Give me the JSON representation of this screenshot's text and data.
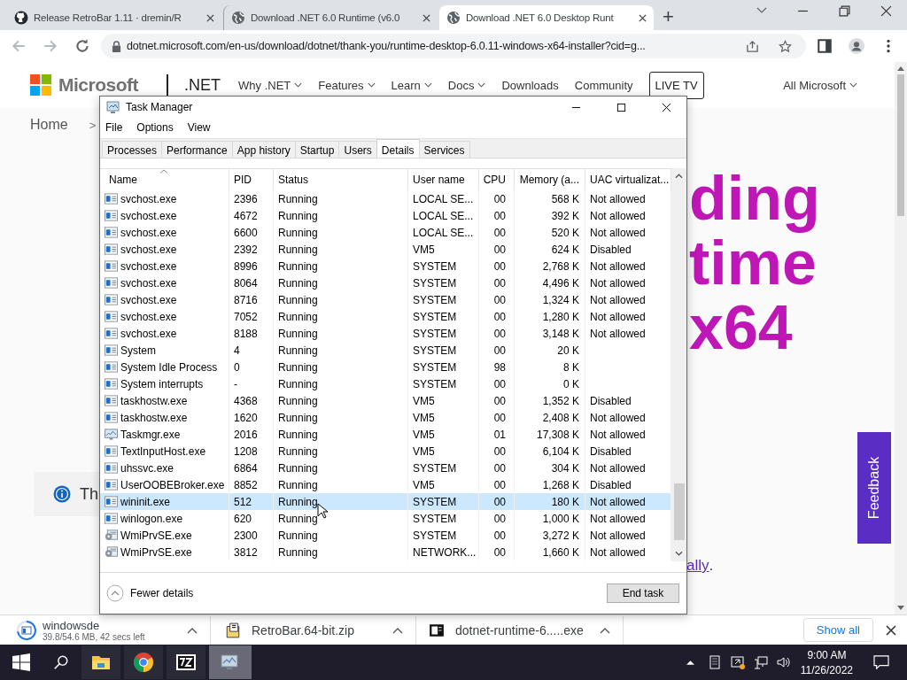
{
  "browser": {
    "tabs": [
      {
        "title": "Release RetroBar 1.11 · dremin/R",
        "kind": "github",
        "selected": false
      },
      {
        "title": "Download .NET 6.0 Runtime (v6.0",
        "kind": "globe",
        "selected": false
      },
      {
        "title": "Download .NET 6.0 Desktop Runt",
        "kind": "globe",
        "selected": true
      }
    ],
    "new_tab": "+",
    "address": "dotnet.microsoft.com/en-us/download/dotnet/thank-you/runtime-desktop-6.0.11-windows-x64-installer?cid=g..."
  },
  "page": {
    "brand": "Microsoft",
    "product": ".NET",
    "nav": [
      {
        "label": "Why .NET",
        "dropdown": true
      },
      {
        "label": "Features",
        "dropdown": true
      },
      {
        "label": "Learn",
        "dropdown": true
      },
      {
        "label": "Docs",
        "dropdown": true
      },
      {
        "label": "Downloads",
        "dropdown": false
      },
      {
        "label": "Community",
        "dropdown": false
      }
    ],
    "live_tv": "LIVE TV",
    "all_microsoft": "All Microsoft",
    "breadcrumb": [
      "Home",
      ">"
    ],
    "headline": [
      "ding",
      "time",
      "x64"
    ],
    "notice": "Th",
    "link": "ally",
    "link_after": ".",
    "feedback": "Feedback"
  },
  "downloads": {
    "items": [
      {
        "name": "windowsde",
        "progress": "39.8/54.6 MB, 42 secs left",
        "kind": "installer"
      },
      {
        "name": "RetroBar.64-bit.zip",
        "kind": "zip"
      },
      {
        "name": "dotnet-runtime-6.....exe",
        "kind": "exe"
      }
    ],
    "show_all": "Show all"
  },
  "task_manager": {
    "title": "Task Manager",
    "menu": [
      "File",
      "Options",
      "View"
    ],
    "tabs": [
      {
        "label": "Processes",
        "selected": false
      },
      {
        "label": "Performance",
        "selected": false
      },
      {
        "label": "App history",
        "selected": false
      },
      {
        "label": "Startup",
        "selected": false
      },
      {
        "label": "Users",
        "selected": false
      },
      {
        "label": "Details",
        "selected": true
      },
      {
        "label": "Services",
        "selected": false
      }
    ],
    "columns": [
      "Name",
      "PID",
      "Status",
      "User name",
      "CPU",
      "Memory (a...",
      "UAC virtualizat..."
    ],
    "rows": [
      {
        "kind": "app",
        "name": "svchost.exe",
        "pid": "2396",
        "status": "Running",
        "user": "LOCAL SE...",
        "cpu": "00",
        "memory": "568 K",
        "uac": "Not allowed",
        "selected": false
      },
      {
        "kind": "app",
        "name": "svchost.exe",
        "pid": "4672",
        "status": "Running",
        "user": "LOCAL SE...",
        "cpu": "00",
        "memory": "392 K",
        "uac": "Not allowed",
        "selected": false
      },
      {
        "kind": "app",
        "name": "svchost.exe",
        "pid": "6600",
        "status": "Running",
        "user": "LOCAL SE...",
        "cpu": "00",
        "memory": "520 K",
        "uac": "Not allowed",
        "selected": false
      },
      {
        "kind": "app",
        "name": "svchost.exe",
        "pid": "2392",
        "status": "Running",
        "user": "VM5",
        "cpu": "00",
        "memory": "624 K",
        "uac": "Disabled",
        "selected": false
      },
      {
        "kind": "app",
        "name": "svchost.exe",
        "pid": "8996",
        "status": "Running",
        "user": "SYSTEM",
        "cpu": "00",
        "memory": "2,768 K",
        "uac": "Not allowed",
        "selected": false
      },
      {
        "kind": "app",
        "name": "svchost.exe",
        "pid": "8064",
        "status": "Running",
        "user": "SYSTEM",
        "cpu": "00",
        "memory": "4,496 K",
        "uac": "Not allowed",
        "selected": false
      },
      {
        "kind": "app",
        "name": "svchost.exe",
        "pid": "8716",
        "status": "Running",
        "user": "SYSTEM",
        "cpu": "00",
        "memory": "1,324 K",
        "uac": "Not allowed",
        "selected": false
      },
      {
        "kind": "app",
        "name": "svchost.exe",
        "pid": "7052",
        "status": "Running",
        "user": "SYSTEM",
        "cpu": "00",
        "memory": "1,280 K",
        "uac": "Not allowed",
        "selected": false
      },
      {
        "kind": "app",
        "name": "svchost.exe",
        "pid": "8188",
        "status": "Running",
        "user": "SYSTEM",
        "cpu": "00",
        "memory": "3,148 K",
        "uac": "Not allowed",
        "selected": false
      },
      {
        "kind": "app",
        "name": "System",
        "pid": "4",
        "status": "Running",
        "user": "SYSTEM",
        "cpu": "00",
        "memory": "20 K",
        "selected": false
      },
      {
        "kind": "app",
        "name": "System Idle Process",
        "pid": "0",
        "status": "Running",
        "user": "SYSTEM",
        "cpu": "98",
        "memory": "8 K",
        "selected": false
      },
      {
        "kind": "app",
        "name": "System interrupts",
        "pid": "-",
        "status": "Running",
        "user": "SYSTEM",
        "cpu": "00",
        "memory": "0 K",
        "selected": false
      },
      {
        "kind": "app",
        "name": "taskhostw.exe",
        "pid": "4368",
        "status": "Running",
        "user": "VM5",
        "cpu": "00",
        "memory": "1,352 K",
        "uac": "Disabled",
        "selected": false
      },
      {
        "kind": "app",
        "name": "taskhostw.exe",
        "pid": "1620",
        "status": "Running",
        "user": "VM5",
        "cpu": "00",
        "memory": "2,408 K",
        "uac": "Not allowed",
        "selected": false
      },
      {
        "kind": "monitor",
        "name": "Taskmgr.exe",
        "pid": "2016",
        "status": "Running",
        "user": "VM5",
        "cpu": "01",
        "memory": "17,308 K",
        "uac": "Not allowed",
        "selected": false
      },
      {
        "kind": "app",
        "name": "TextInputHost.exe",
        "pid": "1208",
        "status": "Running",
        "user": "VM5",
        "cpu": "00",
        "memory": "6,104 K",
        "uac": "Disabled",
        "selected": false
      },
      {
        "kind": "app",
        "name": "uhssvc.exe",
        "pid": "6864",
        "status": "Running",
        "user": "SYSTEM",
        "cpu": "00",
        "memory": "304 K",
        "uac": "Not allowed",
        "selected": false
      },
      {
        "kind": "app",
        "name": "UserOOBEBroker.exe",
        "pid": "8852",
        "status": "Running",
        "user": "VM5",
        "cpu": "00",
        "memory": "1,268 K",
        "uac": "Disabled",
        "selected": false
      },
      {
        "kind": "app",
        "name": "wininit.exe",
        "pid": "512",
        "status": "Running",
        "user": "SYSTEM",
        "cpu": "00",
        "memory": "180 K",
        "uac": "Not allowed",
        "selected": true
      },
      {
        "kind": "app",
        "name": "winlogon.exe",
        "pid": "620",
        "status": "Running",
        "user": "SYSTEM",
        "cpu": "00",
        "memory": "1,000 K",
        "uac": "Not allowed",
        "selected": false
      },
      {
        "kind": "service",
        "name": "WmiPrvSE.exe",
        "pid": "2300",
        "status": "Running",
        "user": "SYSTEM",
        "cpu": "00",
        "memory": "3,272 K",
        "uac": "Not allowed",
        "selected": false
      },
      {
        "kind": "service",
        "name": "WmiPrvSE.exe",
        "pid": "3812",
        "status": "Running",
        "user": "NETWORK...",
        "cpu": "00",
        "memory": "1,660 K",
        "uac": "Not allowed",
        "selected": false
      }
    ],
    "fewer_details": "Fewer details",
    "end_task": "End task"
  },
  "taskbar": {
    "apps": [
      {
        "kind": "folder",
        "active": false
      },
      {
        "kind": "chrome",
        "active": false
      },
      {
        "kind": "archiver",
        "active": false
      },
      {
        "kind": "monitor",
        "active": true
      }
    ],
    "time": "9:00 AM",
    "date": "11/26/2022"
  }
}
